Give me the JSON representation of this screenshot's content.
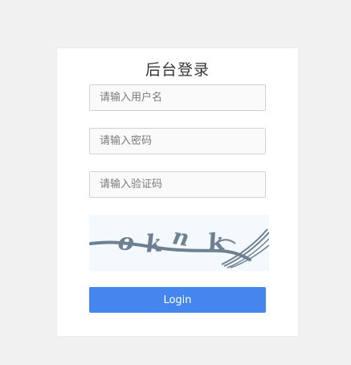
{
  "login": {
    "title": "后台登录",
    "username_placeholder": "请输入用户名",
    "password_placeholder": "请输入密码",
    "captcha_placeholder": "请输入验证码",
    "captcha_text": "okn k",
    "login_label": "Login"
  },
  "colors": {
    "background": "#f1f1f1",
    "card": "#ffffff",
    "button": "#4585ee",
    "captcha_bg": "#f3f9fd",
    "captcha_ink": "#6e8192"
  }
}
